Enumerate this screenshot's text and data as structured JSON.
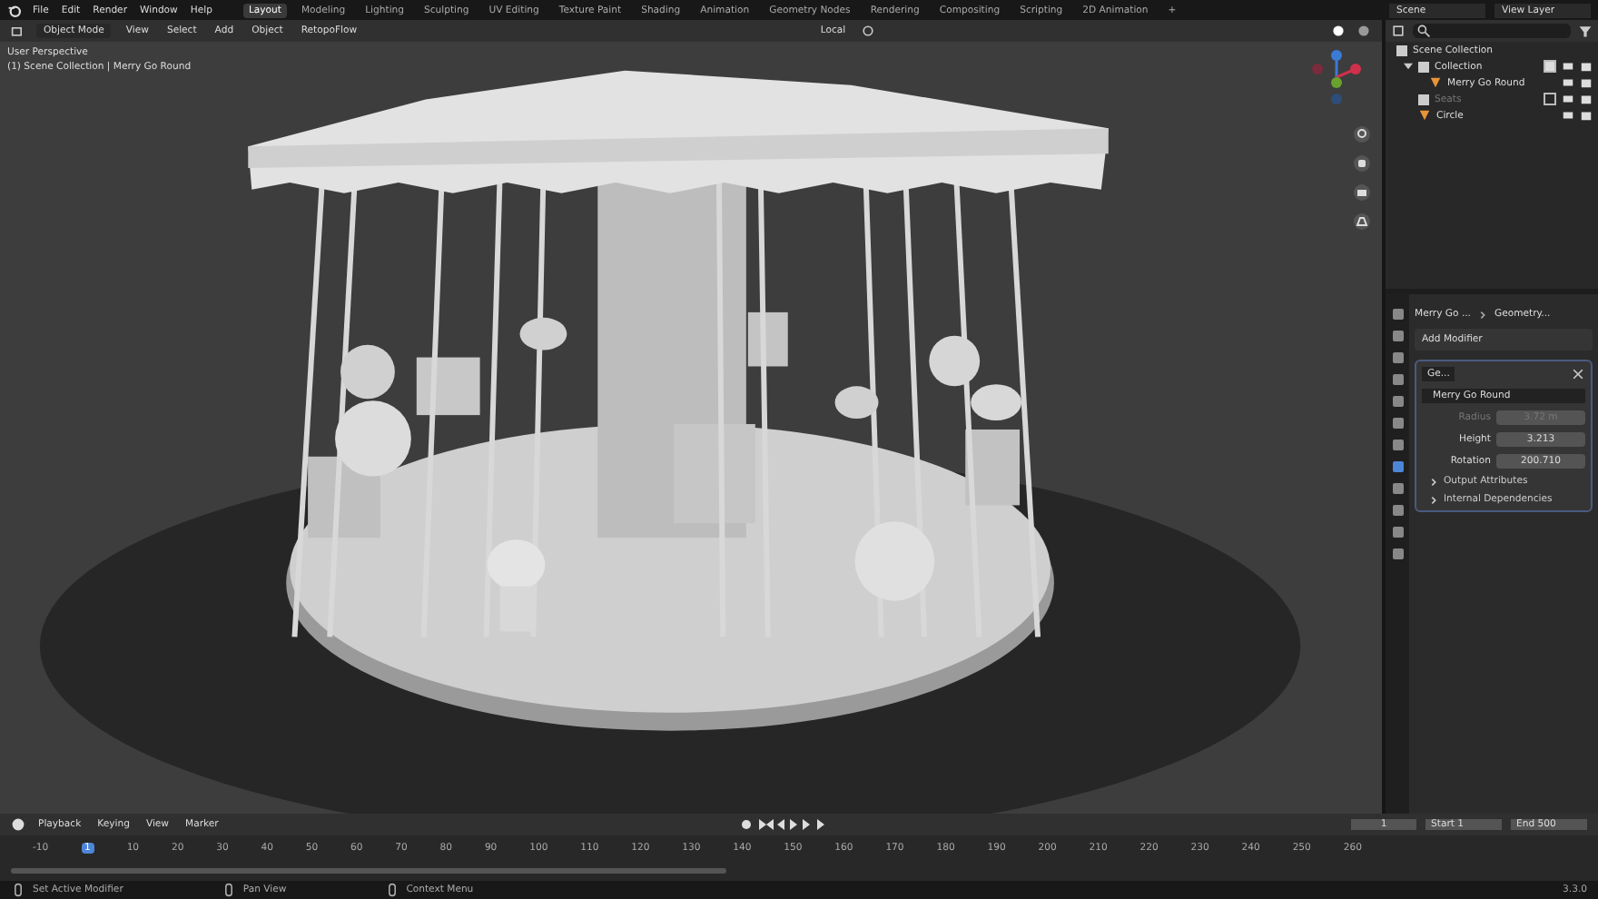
{
  "menu": [
    "File",
    "Edit",
    "Render",
    "Window",
    "Help"
  ],
  "workspaces": [
    {
      "label": "Layout",
      "selected": true
    },
    {
      "label": "Modeling",
      "selected": false
    },
    {
      "label": "Lighting",
      "selected": false
    },
    {
      "label": "Sculpting",
      "selected": false
    },
    {
      "label": "UV Editing",
      "selected": false
    },
    {
      "label": "Texture Paint",
      "selected": false
    },
    {
      "label": "Shading",
      "selected": false
    },
    {
      "label": "Animation",
      "selected": false
    },
    {
      "label": "Geometry Nodes",
      "selected": false
    },
    {
      "label": "Rendering",
      "selected": false
    },
    {
      "label": "Compositing",
      "selected": false
    },
    {
      "label": "Scripting",
      "selected": false
    },
    {
      "label": "2D Animation",
      "selected": false
    }
  ],
  "add_workspace": "+",
  "scene": "Scene",
  "view_layer": "View Layer",
  "viewport_header": {
    "mode": "Object Mode",
    "menus": [
      "View",
      "Select",
      "Add",
      "Object",
      "RetopoFlow"
    ],
    "orientation": "Local"
  },
  "viewport": {
    "view_name": "User Perspective",
    "context": "(1) Scene Collection | Merry Go Round"
  },
  "outliner": {
    "root": "Scene Collection",
    "children": [
      {
        "name": "Collection",
        "kind": "collection",
        "expanded": true,
        "checked": true,
        "excluded": false,
        "children": [
          {
            "name": "Merry Go Round",
            "kind": "object",
            "excluded": false
          }
        ]
      },
      {
        "name": "Seats",
        "kind": "collection",
        "checked": false,
        "excluded": true
      },
      {
        "name": "Circle",
        "kind": "object",
        "excluded": false
      }
    ]
  },
  "property_tabs": [
    {
      "selected": false
    },
    {
      "selected": false
    },
    {
      "selected": false
    },
    {
      "selected": false
    },
    {
      "selected": false
    },
    {
      "selected": false
    },
    {
      "selected": false
    },
    {
      "selected": true
    },
    {
      "selected": false
    },
    {
      "selected": false
    },
    {
      "selected": false
    },
    {
      "selected": false
    }
  ],
  "properties": {
    "breadcrumb": [
      "Merry Go ...",
      "Geometry..."
    ],
    "add_modifier": "Add Modifier",
    "modifier_name": "Ge...",
    "node_group": "Merry Go Round",
    "fields": [
      {
        "label": "Radius",
        "value": "3.72 m",
        "disabled": true
      },
      {
        "label": "Height",
        "value": "3.213",
        "disabled": false
      },
      {
        "label": "Rotation",
        "value": "200.710",
        "disabled": false
      }
    ],
    "subpanels": [
      {
        "label": "Output Attributes",
        "expanded": false
      },
      {
        "label": "Internal Dependencies",
        "expanded": false
      }
    ]
  },
  "timeline": {
    "menus": [
      "Playback",
      "Keying",
      "View",
      "Marker"
    ],
    "current_frame": "1",
    "start_label": "Start",
    "start": "1",
    "end_label": "End",
    "end": "500",
    "ticks": [
      {
        "label": "-10",
        "selected": false
      },
      {
        "label": "1",
        "selected": true
      },
      {
        "label": "10",
        "selected": false
      },
      {
        "label": "20",
        "selected": false
      },
      {
        "label": "30",
        "selected": false
      },
      {
        "label": "40",
        "selected": false
      },
      {
        "label": "50",
        "selected": false
      },
      {
        "label": "60",
        "selected": false
      },
      {
        "label": "70",
        "selected": false
      },
      {
        "label": "80",
        "selected": false
      },
      {
        "label": "90",
        "selected": false
      },
      {
        "label": "100",
        "selected": false
      },
      {
        "label": "110",
        "selected": false
      },
      {
        "label": "120",
        "selected": false
      },
      {
        "label": "130",
        "selected": false
      },
      {
        "label": "140",
        "selected": false
      },
      {
        "label": "150",
        "selected": false
      },
      {
        "label": "160",
        "selected": false
      },
      {
        "label": "170",
        "selected": false
      },
      {
        "label": "180",
        "selected": false
      },
      {
        "label": "190",
        "selected": false
      },
      {
        "label": "200",
        "selected": false
      },
      {
        "label": "210",
        "selected": false
      },
      {
        "label": "220",
        "selected": false
      },
      {
        "label": "230",
        "selected": false
      },
      {
        "label": "240",
        "selected": false
      },
      {
        "label": "250",
        "selected": false
      },
      {
        "label": "260",
        "selected": false
      }
    ]
  },
  "status_bar": {
    "hints": [
      "Set Active Modifier",
      "Pan View",
      "Context Menu"
    ],
    "version": "3.3.0"
  }
}
